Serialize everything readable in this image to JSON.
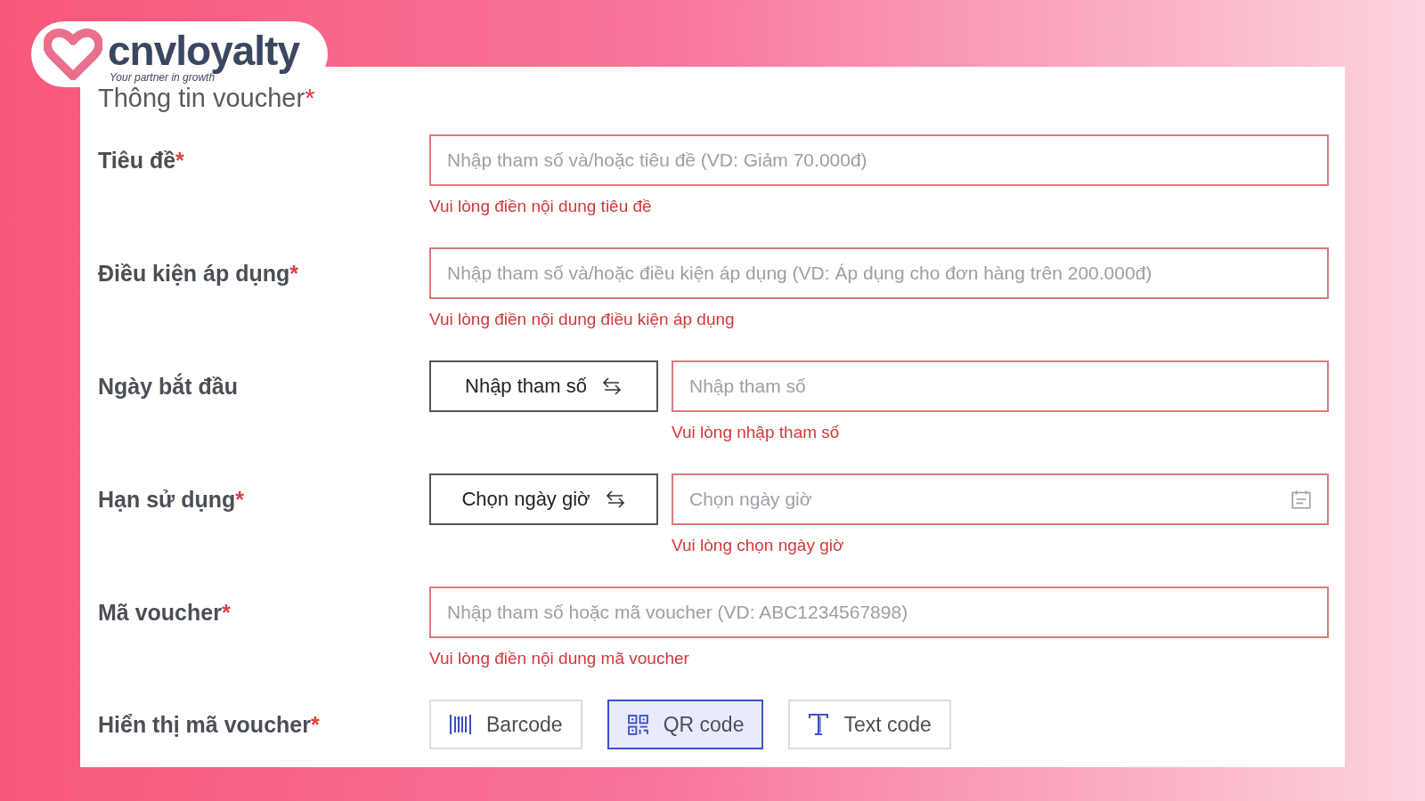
{
  "logo": {
    "brand": "cnvloyalty",
    "tagline": "Your partner in growth"
  },
  "section": {
    "title": "Thông tin voucher",
    "required": true,
    "star": "*"
  },
  "rows": [
    {
      "kind": "input",
      "label": "Tiêu đề",
      "required": true,
      "placeholder": "Nhập tham số và/hoặc tiêu đề (VD: Giảm 70.000đ)",
      "error": "Vui lòng điền nội dung tiêu đề"
    },
    {
      "kind": "input",
      "label": "Điều kiện áp dụng",
      "required": true,
      "placeholder": "Nhập tham số và/hoặc điều kiện áp dụng (VD: Áp dụng cho đơn hàng trên 200.000đ)",
      "error": "Vui lòng điền nội dung điều kiện áp dụng"
    },
    {
      "kind": "switch",
      "label": "Ngày bắt đầu",
      "required": false,
      "mode": "Nhập tham số",
      "placeholder": "Nhập tham số",
      "calendar": false,
      "error": "Vui lòng nhập tham số"
    },
    {
      "kind": "switch",
      "label": "Hạn sử dụng",
      "required": true,
      "mode": "Chọn ngày giờ",
      "placeholder": "Chọn ngày giờ",
      "calendar": true,
      "error": "Vui lòng chọn ngày giờ"
    },
    {
      "kind": "input",
      "label": "Mã voucher",
      "required": true,
      "placeholder": "Nhập tham số hoặc mã voucher (VD: ABC1234567898)",
      "error": "Vui lòng điền nội dung mã voucher"
    },
    {
      "kind": "options",
      "label": "Hiển thị mã voucher",
      "required": true,
      "options": [
        {
          "kind": "barcode",
          "label": "Barcode",
          "selected": false
        },
        {
          "kind": "qr",
          "label": "QR code",
          "selected": true
        },
        {
          "kind": "text",
          "label": "Text code",
          "selected": false
        }
      ]
    }
  ]
}
